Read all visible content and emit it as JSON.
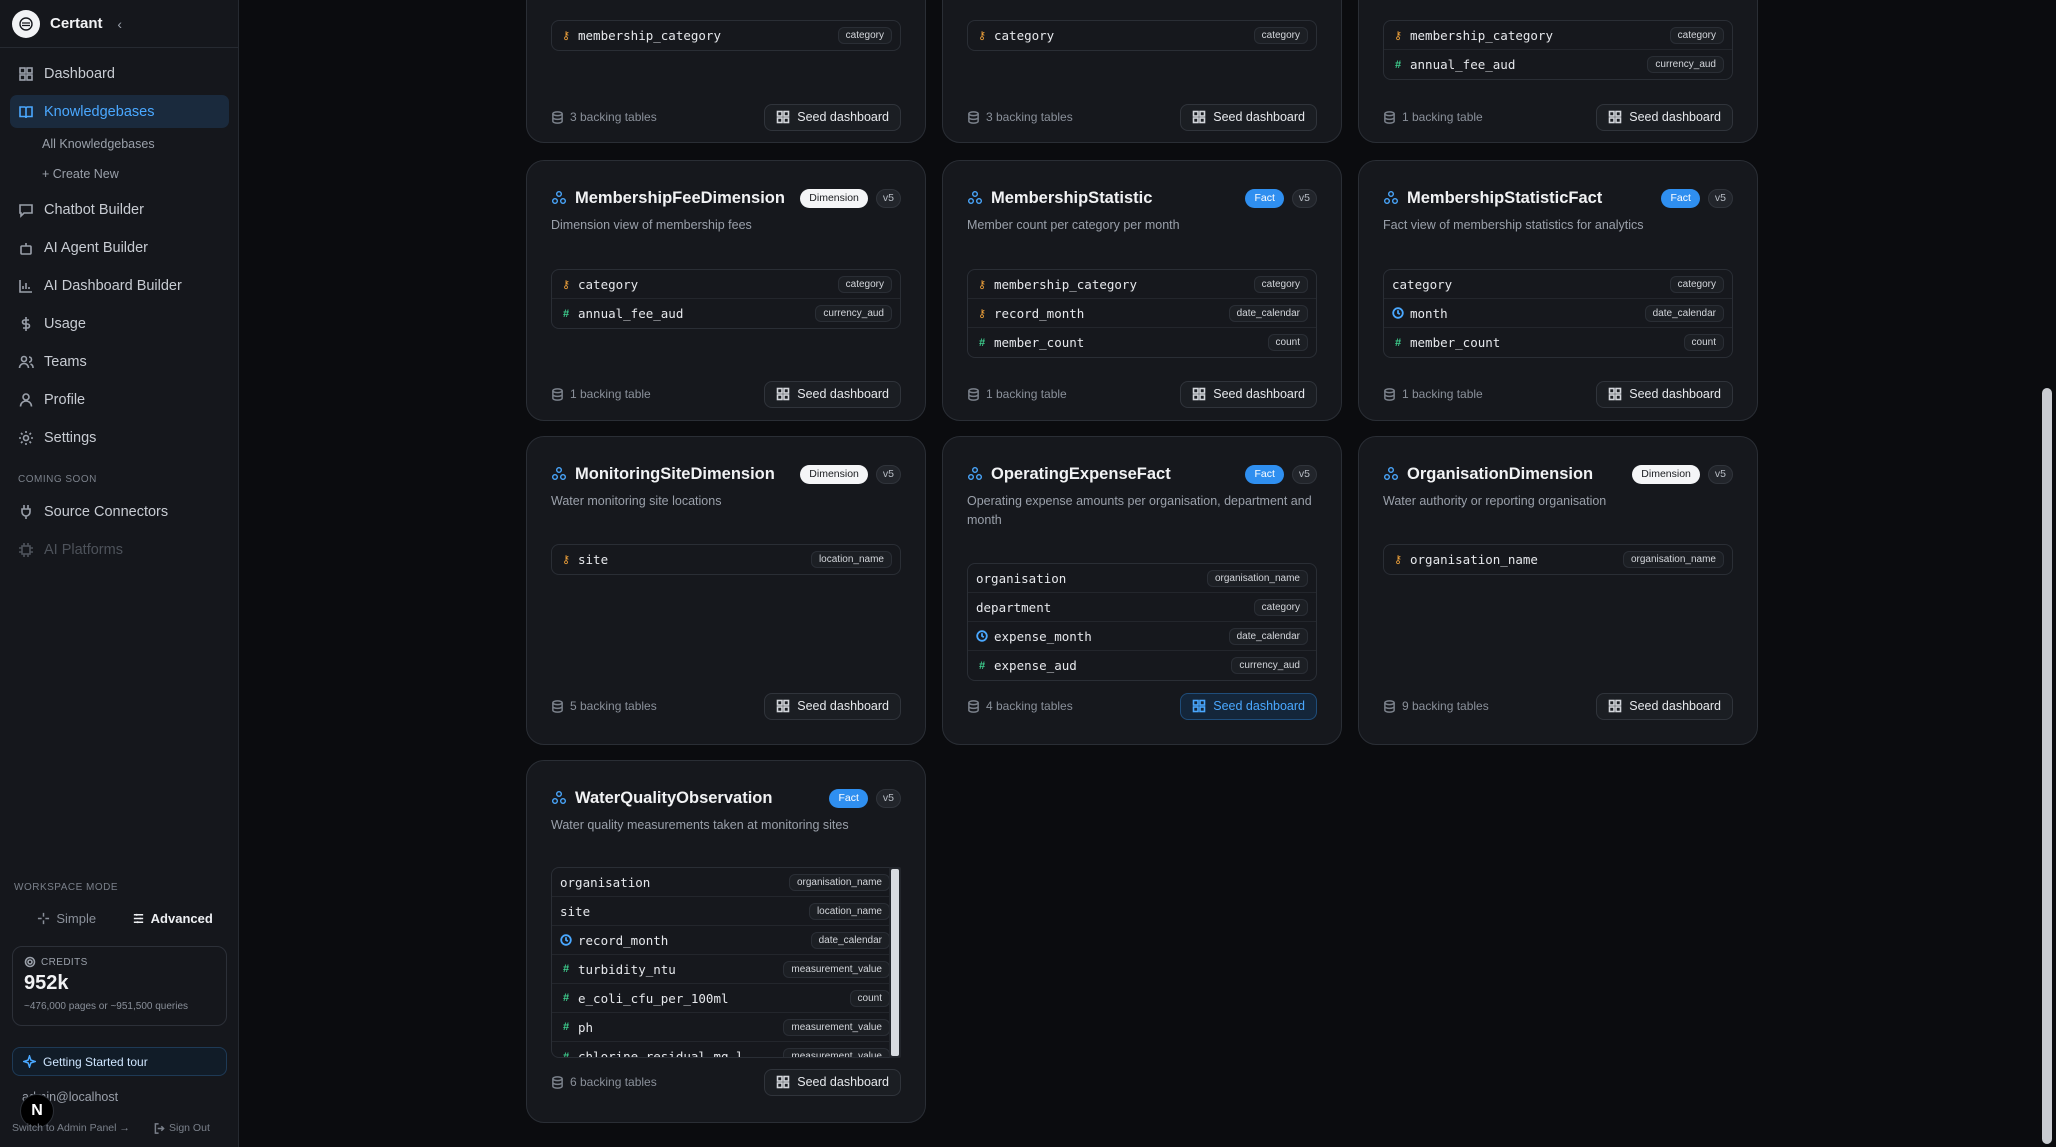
{
  "app": {
    "name": "Certant"
  },
  "sidebar": {
    "collapse_label": "‹",
    "items": [
      {
        "label": "Dashboard",
        "icon": "dashboard-icon"
      },
      {
        "label": "Knowledgebases",
        "icon": "book-icon"
      },
      {
        "label": "Chatbot Builder",
        "icon": "chat-icon"
      },
      {
        "label": "AI Agent Builder",
        "icon": "bot-icon"
      },
      {
        "label": "AI Dashboard Builder",
        "icon": "chart-icon"
      },
      {
        "label": "Usage",
        "icon": "dollar-icon"
      },
      {
        "label": "Teams",
        "icon": "users-icon"
      },
      {
        "label": "Profile",
        "icon": "user-icon"
      },
      {
        "label": "Settings",
        "icon": "gear-icon"
      }
    ],
    "sub_items": [
      "All Knowledgebases",
      "+ Create New"
    ],
    "coming_soon_label": "COMING SOON",
    "coming_soon_items": [
      {
        "label": "Source Connectors",
        "icon": "plug-icon"
      },
      {
        "label": "AI Platforms",
        "icon": "cpu-icon"
      }
    ],
    "workspace_mode_label": "WORKSPACE MODE",
    "mode_simple": "Simple",
    "mode_advanced": "Advanced",
    "credits_label": "CREDITS",
    "credits_value": "952k",
    "credits_note": "~476,000 pages or ~951,500 queries",
    "tour_label": "Getting Started tour",
    "user_email": "admin@localhost",
    "user_badge": "N",
    "switch_admin": "Switch to Admin Panel →",
    "sign_out": "Sign Out"
  },
  "cards": [
    {
      "title": "",
      "badge": "",
      "badge_kind": "",
      "version": "",
      "desc": "",
      "fields": [
        {
          "name": "membership_category",
          "type": "category",
          "icon": "key"
        }
      ],
      "backing": "3 backing tables",
      "seed": "Seed dashboard",
      "highlight": false
    },
    {
      "title": "",
      "badge": "",
      "badge_kind": "",
      "version": "",
      "desc": "",
      "fields": [
        {
          "name": "category",
          "type": "category",
          "icon": "key"
        }
      ],
      "backing": "3 backing tables",
      "seed": "Seed dashboard",
      "highlight": false
    },
    {
      "title": "",
      "badge": "",
      "badge_kind": "",
      "version": "",
      "desc": "",
      "fields": [
        {
          "name": "membership_category",
          "type": "category",
          "icon": "key"
        },
        {
          "name": "annual_fee_aud",
          "type": "currency_aud",
          "icon": "hash"
        }
      ],
      "backing": "1 backing table",
      "seed": "Seed dashboard",
      "highlight": false
    },
    {
      "title": "MembershipFeeDimension",
      "badge": "Dimension",
      "badge_kind": "dim",
      "version": "v5",
      "desc": "Dimension view of membership fees",
      "fields": [
        {
          "name": "category",
          "type": "category",
          "icon": "key"
        },
        {
          "name": "annual_fee_aud",
          "type": "currency_aud",
          "icon": "hash"
        }
      ],
      "backing": "1 backing table",
      "seed": "Seed dashboard",
      "highlight": false
    },
    {
      "title": "MembershipStatistic",
      "badge": "Fact",
      "badge_kind": "fact",
      "version": "v5",
      "desc": "Member count per category per month",
      "fields": [
        {
          "name": "membership_category",
          "type": "category",
          "icon": "key"
        },
        {
          "name": "record_month",
          "type": "date_calendar",
          "icon": "key"
        },
        {
          "name": "member_count",
          "type": "count",
          "icon": "hash"
        }
      ],
      "backing": "1 backing table",
      "seed": "Seed dashboard",
      "highlight": false
    },
    {
      "title": "MembershipStatisticFact",
      "badge": "Fact",
      "badge_kind": "fact",
      "version": "v5",
      "desc": "Fact view of membership statistics for analytics",
      "fields": [
        {
          "name": "category",
          "type": "category",
          "icon": ""
        },
        {
          "name": "month",
          "type": "date_calendar",
          "icon": "clock"
        },
        {
          "name": "member_count",
          "type": "count",
          "icon": "hash"
        }
      ],
      "backing": "1 backing table",
      "seed": "Seed dashboard",
      "highlight": false
    },
    {
      "title": "MonitoringSiteDimension",
      "badge": "Dimension",
      "badge_kind": "dim",
      "version": "v5",
      "desc": "Water monitoring site locations",
      "fields": [
        {
          "name": "site",
          "type": "location_name",
          "icon": "key"
        }
      ],
      "backing": "5 backing tables",
      "seed": "Seed dashboard",
      "highlight": false
    },
    {
      "title": "OperatingExpenseFact",
      "badge": "Fact",
      "badge_kind": "fact",
      "version": "v5",
      "desc": "Operating expense amounts per organisation, department and month",
      "fields": [
        {
          "name": "organisation",
          "type": "organisation_name",
          "icon": ""
        },
        {
          "name": "department",
          "type": "category",
          "icon": ""
        },
        {
          "name": "expense_month",
          "type": "date_calendar",
          "icon": "clock"
        },
        {
          "name": "expense_aud",
          "type": "currency_aud",
          "icon": "hash"
        }
      ],
      "backing": "4 backing tables",
      "seed": "Seed dashboard",
      "highlight": true
    },
    {
      "title": "OrganisationDimension",
      "badge": "Dimension",
      "badge_kind": "dim",
      "version": "v5",
      "desc": "Water authority or reporting organisation",
      "fields": [
        {
          "name": "organisation_name",
          "type": "organisation_name",
          "icon": "key"
        }
      ],
      "backing": "9 backing tables",
      "seed": "Seed dashboard",
      "highlight": false
    },
    {
      "title": "WaterQualityObservation",
      "badge": "Fact",
      "badge_kind": "fact",
      "version": "v5",
      "desc": "Water quality measurements taken at monitoring sites",
      "fields": [
        {
          "name": "organisation",
          "type": "organisation_name",
          "icon": ""
        },
        {
          "name": "site",
          "type": "location_name",
          "icon": ""
        },
        {
          "name": "record_month",
          "type": "date_calendar",
          "icon": "clock"
        },
        {
          "name": "turbidity_ntu",
          "type": "measurement_value",
          "icon": "hash"
        },
        {
          "name": "e_coli_cfu_per_100ml",
          "type": "count",
          "icon": "hash"
        },
        {
          "name": "ph",
          "type": "measurement_value",
          "icon": "hash"
        },
        {
          "name": "chlorine_residual_mg_l",
          "type": "measurement_value",
          "icon": "hash"
        }
      ],
      "backing": "6 backing tables",
      "seed": "Seed dashboard",
      "highlight": false
    }
  ]
}
